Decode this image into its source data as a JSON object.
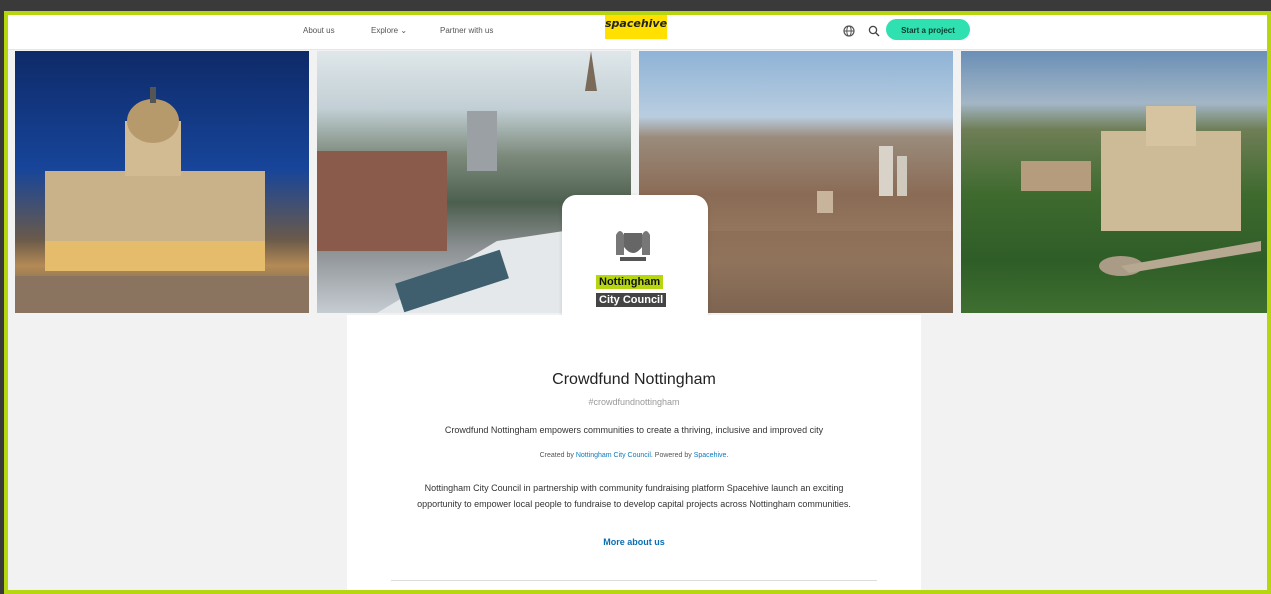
{
  "nav": {
    "about": "About us",
    "explore": "Explore ⌄",
    "partner": "Partner with us",
    "logo": "spacehive",
    "start_button": "Start a project"
  },
  "icons": {
    "globe": "globe-icon",
    "search": "search-icon",
    "crest": "coat-of-arms-icon"
  },
  "colors": {
    "frame_border": "#b8d60f",
    "logo_bg": "#ffe000",
    "start_button_bg": "#2fe0b0",
    "link": "#0a6fb2"
  },
  "photos": [
    "Nottingham Council House",
    "Tram crossing bridge",
    "Aerial city view",
    "Wollaton Hall"
  ],
  "logo_card": {
    "line1": "Nottingham",
    "line2": "City Council"
  },
  "main": {
    "title": "Crowdfund Nottingham",
    "hashtag": "#crowdfundnottingham",
    "intro": "Crowdfund Nottingham empowers communities to create a thriving, inclusive and improved city",
    "created_by_prefix": "Created by ",
    "created_by_link": "Nottingham City Council",
    "powered_by_prefix": ". Powered by ",
    "powered_by_link": "Spacehive",
    "powered_by_suffix": ".",
    "description": "Nottingham City Council in partnership with community fundraising platform Spacehive launch an exciting opportunity to empower local people to fundraise to develop capital projects across Nottingham communities.",
    "more_link": "More about us"
  }
}
